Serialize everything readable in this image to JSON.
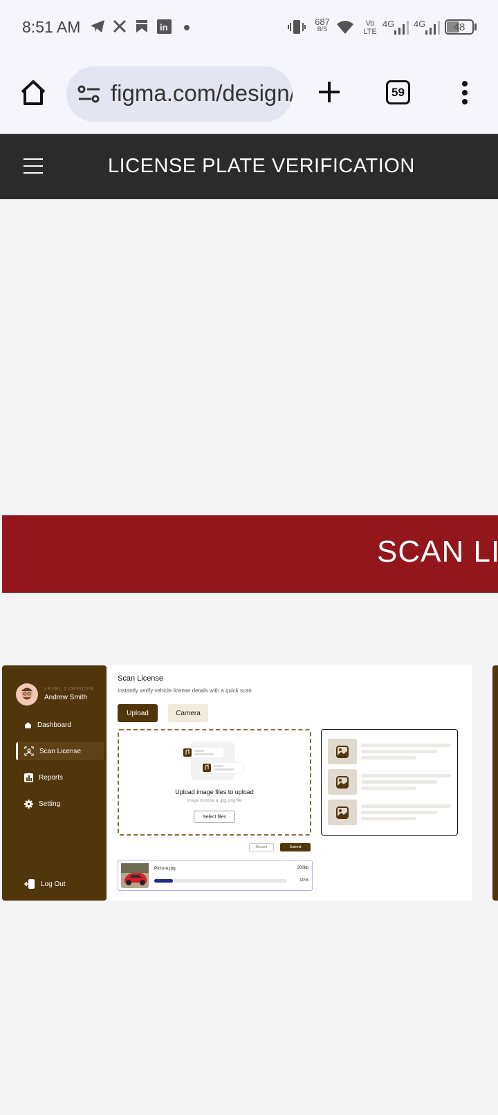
{
  "status_bar": {
    "time": "8:51 AM",
    "net_speed_value": "687",
    "net_speed_unit": "B/S",
    "volte_top": "Vo",
    "volte_bottom": "LTE",
    "net1": "4G",
    "net2": "4G",
    "battery": "48"
  },
  "browser": {
    "url": "figma.com/design/",
    "tab_count": "59"
  },
  "app_bar": {
    "title": "LICENSE PLATE VERIFICATION"
  },
  "banner": {
    "text": "SCAN LICENSE"
  },
  "dashboard": {
    "user": {
      "level": "LEVEL 2 OFFICER",
      "name": "Andrew Smith"
    },
    "nav": [
      {
        "label": "Dashboard",
        "icon": "home-icon"
      },
      {
        "label": "Scan License",
        "icon": "scan-icon",
        "active": true
      },
      {
        "label": "Reports",
        "icon": "reports-icon"
      },
      {
        "label": "Setting",
        "icon": "gear-icon"
      }
    ],
    "logout_label": "Log Out",
    "page_title": "Scan License",
    "page_subtitle": "Instantly verify vehicle license details with a quick scan",
    "tabs": {
      "upload": "Upload",
      "camera": "Camera"
    },
    "upload_box": {
      "heading": "Upload image files to upload",
      "hint": "Image must be a .jpg, png file",
      "select_button": "Select files"
    },
    "actions": {
      "discard": "Discard",
      "submit": "Submit"
    },
    "file": {
      "name": "Picture.jpg",
      "size": "300kb",
      "progress_label": "10%",
      "progress": 0.1
    },
    "colors": {
      "brand_brown": "#51350b",
      "banner_red": "#92161a",
      "progress_blue": "#1f2a8a"
    }
  }
}
